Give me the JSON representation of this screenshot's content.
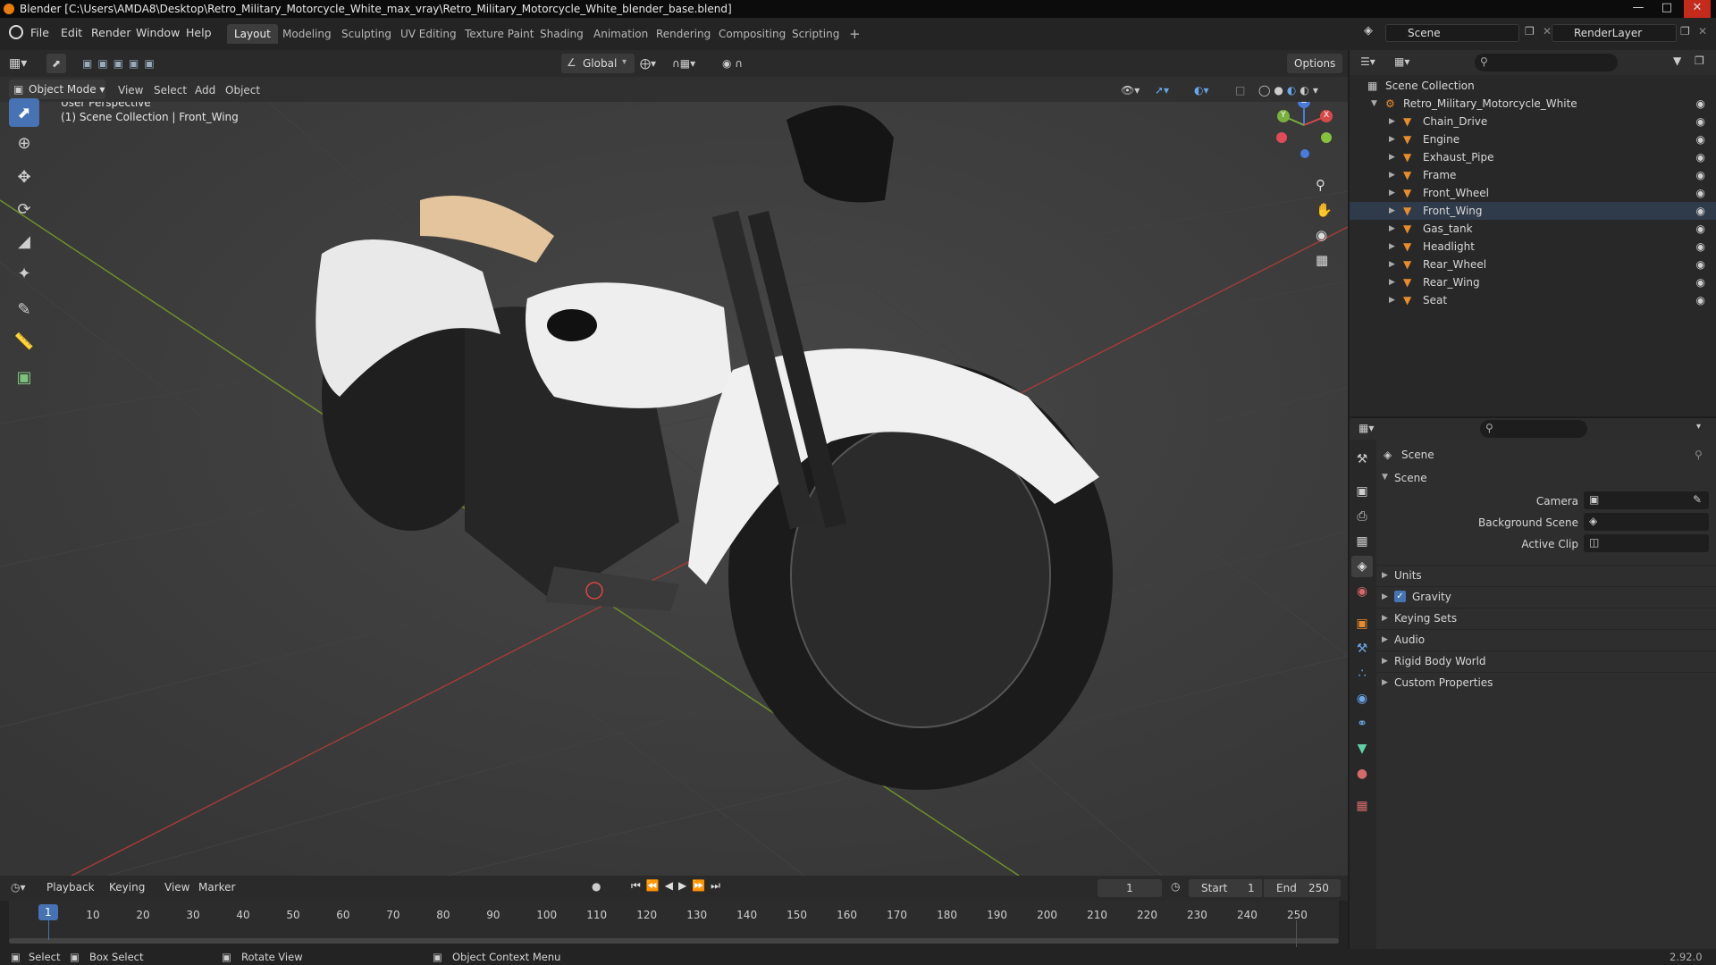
{
  "window": {
    "title": "Blender [C:\\Users\\AMDA8\\Desktop\\Retro_Military_Motorcycle_White_max_vray\\Retro_Military_Motorcycle_White_blender_base.blend]",
    "minimize": "—",
    "maximize": "□",
    "close": "✕"
  },
  "menus": [
    "File",
    "Edit",
    "Render",
    "Window",
    "Help"
  ],
  "workspaces": [
    "Layout",
    "Modeling",
    "Sculpting",
    "UV Editing",
    "Texture Paint",
    "Shading",
    "Animation",
    "Rendering",
    "Compositing",
    "Scripting"
  ],
  "add_workspace": "+",
  "scene_field": "Scene",
  "renderlayer_field": "RenderLayer",
  "viewport_header": {
    "transform_orientation": "Global",
    "options": "Options"
  },
  "viewport_menu": {
    "mode": "Object Mode",
    "items": [
      "View",
      "Select",
      "Add",
      "Object"
    ]
  },
  "viewport_info": {
    "line1": "User Perspective",
    "line2": "(1) Scene Collection | Front_Wing"
  },
  "gizmo": {
    "x": "X",
    "y": "Y",
    "z": "Z"
  },
  "outliner": {
    "root": "Scene Collection",
    "collection": "Retro_Military_Motorcycle_White",
    "objects": [
      "Chain_Drive",
      "Engine",
      "Exhaust_Pipe",
      "Frame",
      "Front_Wheel",
      "Front_Wing",
      "Gas_tank",
      "Headlight",
      "Rear_Wheel",
      "Rear_Wing",
      "Seat"
    ]
  },
  "properties": {
    "context": "Scene",
    "section": "Scene",
    "fields": [
      {
        "label": "Camera"
      },
      {
        "label": "Background Scene"
      },
      {
        "label": "Active Clip"
      }
    ],
    "panels": [
      "Units",
      "Gravity",
      "Keying Sets",
      "Audio",
      "Rigid Body World",
      "Custom Properties"
    ]
  },
  "timeline": {
    "menus": [
      "Playback",
      "Keying",
      "View",
      "Marker"
    ],
    "current_frame": "1",
    "start_label": "Start",
    "start": "1",
    "end_label": "End",
    "end": "250",
    "ruler": [
      "1",
      "10",
      "20",
      "30",
      "40",
      "50",
      "60",
      "70",
      "80",
      "90",
      "100",
      "110",
      "120",
      "130",
      "140",
      "150",
      "160",
      "170",
      "180",
      "190",
      "200",
      "210",
      "220",
      "230",
      "240",
      "250"
    ]
  },
  "statusbar": {
    "select": "Select",
    "box_select": "Box Select",
    "rotate": "Rotate View",
    "context_menu": "Object Context Menu",
    "version": "2.92.0"
  },
  "colors": {
    "accent": "#4772b3",
    "object": "#e88d2d",
    "mesh": "#5ed1a7",
    "grid_x": "#a23b3b",
    "grid_y": "#6f8f2a"
  }
}
